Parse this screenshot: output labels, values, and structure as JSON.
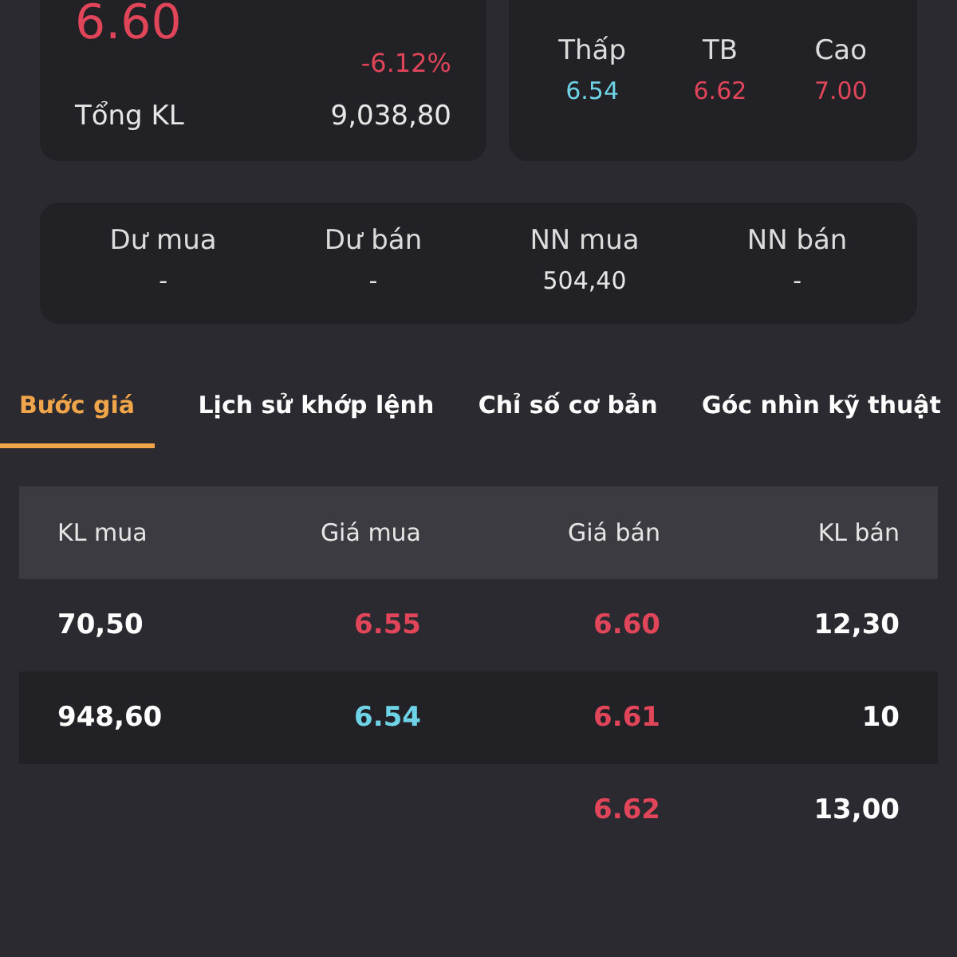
{
  "quote": {
    "price": "6.60",
    "color": "#e0455a",
    "change": "-6.12%",
    "volume_label": "Tổng KL",
    "volume": "9,038,80"
  },
  "range": [
    {
      "label": "Thấp",
      "value": "6.54",
      "color": "#6fd3e8"
    },
    {
      "label": "TB",
      "value": "6.62",
      "color": "#e0455a"
    },
    {
      "label": "Cao",
      "value": "7.00",
      "color": "#e0455a"
    }
  ],
  "flows": [
    {
      "label": "Dư mua",
      "value": "-"
    },
    {
      "label": "Dư bán",
      "value": "-"
    },
    {
      "label": "NN mua",
      "value": "504,40"
    },
    {
      "label": "NN bán",
      "value": "-"
    }
  ],
  "tabs": [
    {
      "label": "Bước giá",
      "selected": true
    },
    {
      "label": "Lịch sử khớp lệnh",
      "selected": false
    },
    {
      "label": "Chỉ số cơ bản",
      "selected": false
    },
    {
      "label": "Góc nhìn kỹ thuật",
      "selected": false
    }
  ],
  "table": {
    "columns": [
      "KL mua",
      "Giá mua",
      "Giá bán",
      "KL bán"
    ],
    "rows": [
      [
        {
          "text": "70,50"
        },
        {
          "text": "6.55",
          "color": "#e0455a"
        },
        {
          "text": "6.60",
          "color": "#e0455a"
        },
        {
          "text": "12,30"
        }
      ],
      [
        {
          "text": "948,60"
        },
        {
          "text": "6.54",
          "color": "#6fd3e8"
        },
        {
          "text": "6.61",
          "color": "#e0455a"
        },
        {
          "text": "10"
        }
      ],
      [
        null,
        null,
        {
          "text": "6.62",
          "color": "#e0455a"
        },
        {
          "text": "13,00"
        }
      ]
    ]
  }
}
